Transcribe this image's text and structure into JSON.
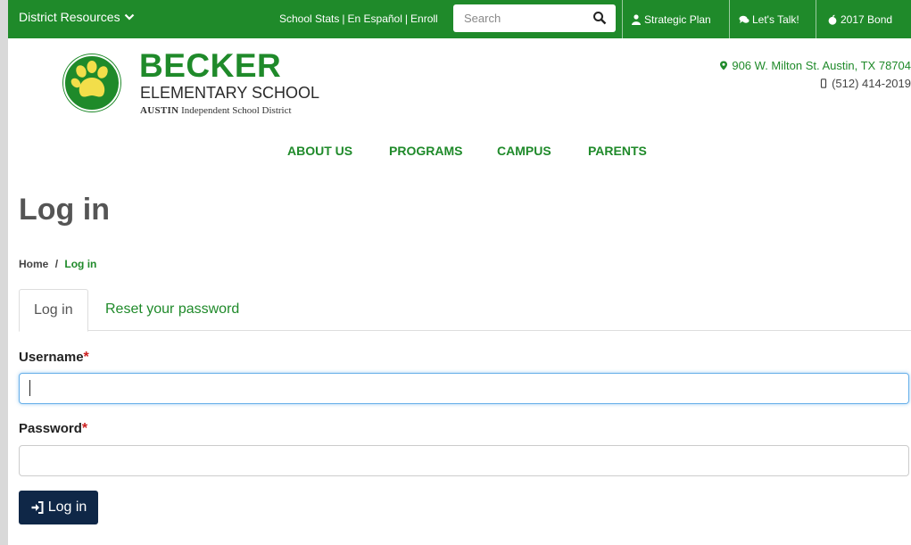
{
  "colors": {
    "brand_green": "#1f8a2a",
    "button_navy": "#0f2747",
    "required_red": "#cc1f1f"
  },
  "topbar": {
    "district_resources": "District Resources",
    "link_school_stats": "School Stats",
    "link_espanol": "En Español",
    "link_enroll": "Enroll",
    "separator": "|",
    "search_placeholder": "Search",
    "strategic_plan": "Strategic Plan",
    "lets_talk": "Let's Talk!",
    "bond": "2017 Bond",
    "icons": [
      "chevron-down-icon",
      "search-icon",
      "person-icon",
      "chat-icon",
      "apple-icon"
    ]
  },
  "header": {
    "school_name": "BECKER",
    "school_type": "ELEMENTARY SCHOOL",
    "district_bold": "AUSTIN",
    "district_rest": " Independent School District",
    "address": "906 W. Milton St. Austin, TX 78704",
    "phone": "(512) 414-2019"
  },
  "nav": {
    "about": "ABOUT US",
    "programs": "PROGRAMS",
    "campus": "CAMPUS",
    "parents": "PARENTS"
  },
  "main": {
    "title": "Log in",
    "breadcrumb": {
      "home": "Home",
      "sep": "/",
      "current": "Log in"
    },
    "tabs": {
      "login": "Log in",
      "reset": "Reset your password"
    },
    "username_label": "Username",
    "password_label": "Password",
    "required_mark": "*",
    "username_value": "",
    "password_value": "",
    "submit_label": "Log in"
  }
}
